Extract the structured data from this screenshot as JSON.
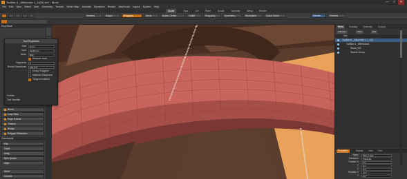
{
  "window": {
    "title": "ToolBar & _Milerlooks 1_1(Q3).lxo* - Modo",
    "controls": [
      "—",
      "□",
      "✕"
    ]
  },
  "menu": [
    "File",
    "Edit",
    "View",
    "Select",
    "Item",
    "Geometry",
    "Texture",
    "Vertex Map",
    "Animate",
    "Dynamics",
    "Render",
    "MaxScript",
    "Layout",
    "System",
    "Help"
  ],
  "layout_tabs": [
    "Model",
    "Topo",
    "UV",
    "Paint",
    "Sculpt",
    "Animate",
    "Setup",
    "Render"
  ],
  "layout_tabs_active": "Model",
  "toolbar": {
    "items": [
      "Vertices",
      "Edges",
      "Polygons",
      "Items",
      "Action Center",
      "Falloff",
      "Snapping",
      "Symmetry",
      "Workplane",
      "Quick Select",
      "Render",
      "Preview"
    ],
    "active": "Polygons"
  },
  "left_panel": {
    "header": "Poly Bevel",
    "tools": [
      "Bevel",
      "Loop Slice",
      "Edge Extend",
      "Thicken",
      "Bridge",
      "Polygon Reduction",
      "Commands",
      "Flip",
      "Triple",
      "Unify",
      "Spin Quads",
      "Align"
    ],
    "scroll_items": [
      "Weld",
      "Unweld"
    ]
  },
  "tool_properties": {
    "title": "Tool Properties",
    "rows": [
      {
        "label": "Shift",
        "value": "0 mm"
      },
      {
        "label": "Inset",
        "value": "21.85 mm"
      },
      {
        "label": "Mode",
        "value": "Both"
      },
      {
        "label": "Segments",
        "value": "2"
      },
      {
        "label": "Round Roundness",
        "value": "100.0 %"
      }
    ],
    "checks": [
      {
        "label": "Absolute Inset",
        "on": true
      },
      {
        "label": "Group Polygons",
        "on": false
      },
      {
        "label": "Maintain Sharpness",
        "on": false
      },
      {
        "label": "Tangent Enabled",
        "on": true
      }
    ],
    "footer": [
      "Profiles",
      "Tool Handles"
    ]
  },
  "items_panel": {
    "tabs": [
      "Items",
      "Shading",
      "Channels",
      "Groups"
    ],
    "active_tab": "Items",
    "tools": [
      "Add Item",
      "Filter",
      "Edit"
    ],
    "column": "Item",
    "rows": [
      {
        "label": "ToolBar & _Milerlooks 1_1_Q3",
        "indent": 0,
        "selected": true
      },
      {
        "label": "ToolBar & _Milerlooks1",
        "indent": 1,
        "selected": false
      },
      {
        "label": "Wood_001",
        "indent": 2,
        "selected": false
      },
      {
        "label": "Texture Group",
        "indent": 2,
        "selected": false
      }
    ]
  },
  "properties_panel": {
    "tabs": [
      "Properties",
      "Display",
      "Lists",
      "Tool"
    ],
    "active_tab": "Properties",
    "rows": [
      {
        "key": "Name",
        "value": "Main_Layer"
      },
      {
        "key": "Transform",
        "value": "Translate"
      },
      {
        "key": "Position X",
        "value": "0 m"
      },
      {
        "key": "Y",
        "value": "0 m"
      },
      {
        "key": "Z",
        "value": "0 m"
      },
      {
        "key": "Rotation X",
        "value": "0.0 °"
      },
      {
        "key": "Y",
        "value": "0.0 °"
      }
    ]
  },
  "colors": {
    "accent": "#c86f14",
    "selection": "#3d5f86",
    "mesh": "#c9645c",
    "mesh_shadow": "#7a3733",
    "wood": "#6a4a36",
    "floor_orange": "#e8a25a"
  }
}
